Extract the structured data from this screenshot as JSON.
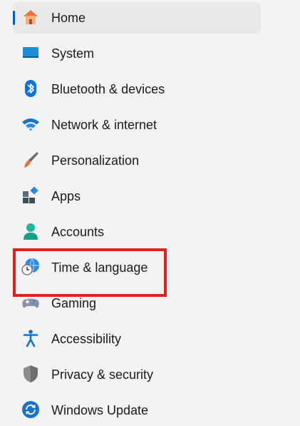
{
  "nav": {
    "items": [
      {
        "label": "Home",
        "icon": "home-icon",
        "selected": true
      },
      {
        "label": "System",
        "icon": "system-icon"
      },
      {
        "label": "Bluetooth & devices",
        "icon": "bluetooth-icon"
      },
      {
        "label": "Network & internet",
        "icon": "wifi-icon"
      },
      {
        "label": "Personalization",
        "icon": "brush-icon"
      },
      {
        "label": "Apps",
        "icon": "apps-icon"
      },
      {
        "label": "Accounts",
        "icon": "accounts-icon"
      },
      {
        "label": "Time & language",
        "icon": "time-language-icon",
        "highlighted": true
      },
      {
        "label": "Gaming",
        "icon": "gamepad-icon"
      },
      {
        "label": "Accessibility",
        "icon": "accessibility-icon"
      },
      {
        "label": "Privacy & security",
        "icon": "shield-icon"
      },
      {
        "label": "Windows Update",
        "icon": "windows-update-icon"
      }
    ]
  },
  "colors": {
    "selected_background": "#e9e9e9",
    "selection_indicator": "#005fb8",
    "highlight_border": "#e3201b"
  }
}
